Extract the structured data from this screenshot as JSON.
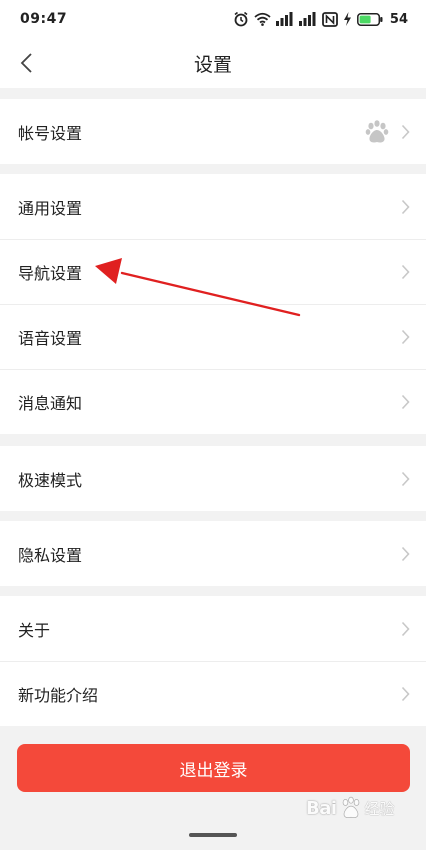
{
  "status_bar": {
    "time": "09:47",
    "battery_level": "54",
    "icons": [
      "alarm-icon",
      "wifi-icon",
      "signal-icon",
      "signal-icon",
      "nfc-icon",
      "charging-icon",
      "battery-icon"
    ]
  },
  "nav": {
    "title": "设置",
    "back_icon": "chevron-left-icon"
  },
  "groups": [
    [
      {
        "label": "帐号设置",
        "trailing_icon": "baidu-paw-icon"
      }
    ],
    [
      {
        "label": "通用设置"
      },
      {
        "label": "导航设置"
      },
      {
        "label": "语音设置"
      },
      {
        "label": "消息通知"
      }
    ],
    [
      {
        "label": "极速模式"
      }
    ],
    [
      {
        "label": "隐私设置"
      }
    ],
    [
      {
        "label": "关于"
      },
      {
        "label": "新功能介绍"
      }
    ]
  ],
  "logout_label": "退出登录",
  "annotation": {
    "type": "red-arrow",
    "points_to": "导航设置"
  },
  "watermark": {
    "brand": "Bai",
    "suffix": "经验"
  },
  "colors": {
    "accent_red": "#f4493a",
    "arrow_red": "#e02020",
    "page_background": "#f2f2f2",
    "battery_green": "#4cd964"
  }
}
